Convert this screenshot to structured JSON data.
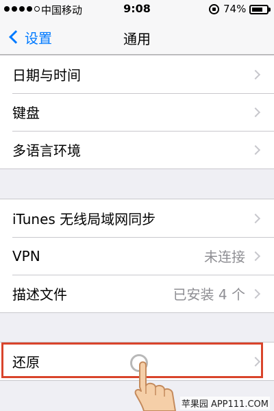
{
  "status_bar": {
    "carrier": "中国移动",
    "time": "9:08",
    "battery_percent": "74%",
    "battery_level": 0.74,
    "signal_bars": 5,
    "signal_filled": 4
  },
  "nav": {
    "back_label": "设置",
    "title": "通用"
  },
  "groups": [
    {
      "rows": [
        {
          "label": "日期与时间"
        },
        {
          "label": "键盘"
        },
        {
          "label": "多语言环境"
        }
      ]
    },
    {
      "rows": [
        {
          "label": "iTunes 无线局域网同步"
        },
        {
          "label": "VPN",
          "detail": "未连接"
        },
        {
          "label": "描述文件",
          "detail": "已安装 4 个"
        }
      ]
    },
    {
      "rows": [
        {
          "label": "还原"
        }
      ]
    }
  ],
  "watermark": "苹果园 APP111.COM",
  "colors": {
    "accent": "#007aff",
    "highlight": "#d9442b",
    "background": "#efeff4"
  }
}
